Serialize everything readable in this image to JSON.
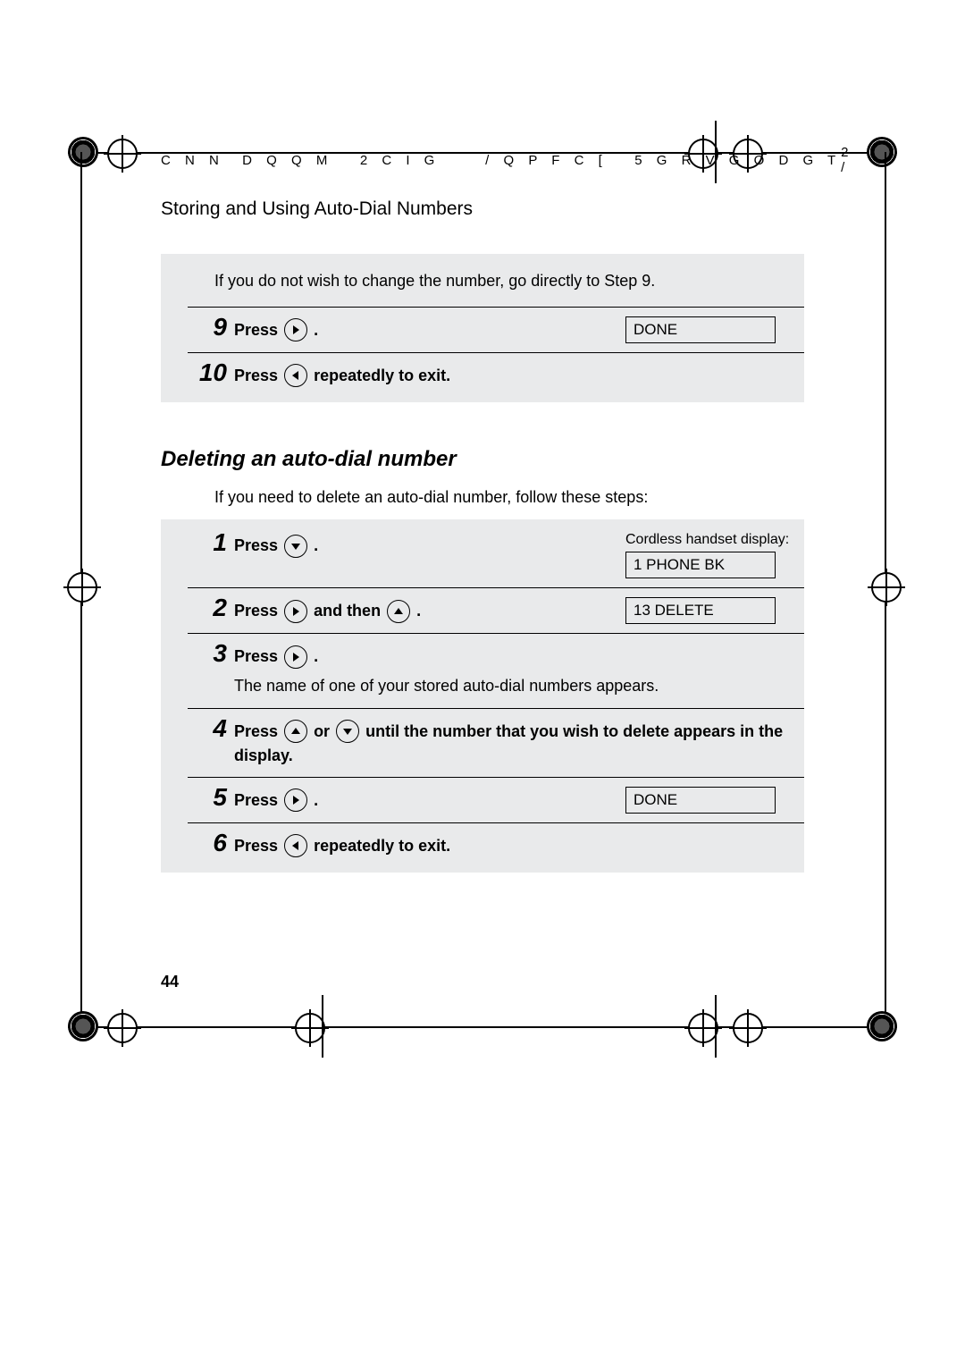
{
  "header": {
    "left": "C N N  D Q Q M   2 C I G     / Q P F C [   5 G R V G O D G T",
    "right": "2 /"
  },
  "section_title": "Storing and Using Auto-Dial Numbers",
  "block_a": {
    "note": "If you do not wish to change the number, go directly to Step 9.",
    "steps": [
      {
        "num": "9",
        "pre": "Press ",
        "icon": "right",
        "post": " .",
        "display": "DONE"
      },
      {
        "num": "10",
        "pre": "Press ",
        "icon": "left",
        "post": "  repeatedly to exit."
      }
    ]
  },
  "subsection_title": "Deleting an auto-dial number",
  "intro": "If you need to delete an auto-dial number, follow these steps:",
  "block_b": {
    "display_label": "Cordless handset display:",
    "steps": {
      "s1": {
        "num": "1",
        "pre": "Press ",
        "icon": "down",
        "post": " .",
        "display": "1  PHONE BK"
      },
      "s2": {
        "num": "2",
        "pre": "Press ",
        "icon1": "right",
        "mid": "  and then  ",
        "icon2": "up",
        "post": " .",
        "display": "13 DELETE"
      },
      "s3": {
        "num": "3",
        "pre": "Press ",
        "icon": "right",
        "post": " .",
        "extra": "The name of one of your stored auto-dial numbers appears."
      },
      "s4": {
        "num": "4",
        "pre": "Press ",
        "icon1": "up",
        "mid1": "  or  ",
        "icon2": "down",
        "post": "  until the number that you wish to delete appears in the display."
      },
      "s5": {
        "num": "5",
        "pre": "Press ",
        "icon": "right",
        "post": " .",
        "display": "DONE"
      },
      "s6": {
        "num": "6",
        "pre": "Press ",
        "icon": "left",
        "post": "  repeatedly to exit."
      }
    }
  },
  "page_number": "44"
}
